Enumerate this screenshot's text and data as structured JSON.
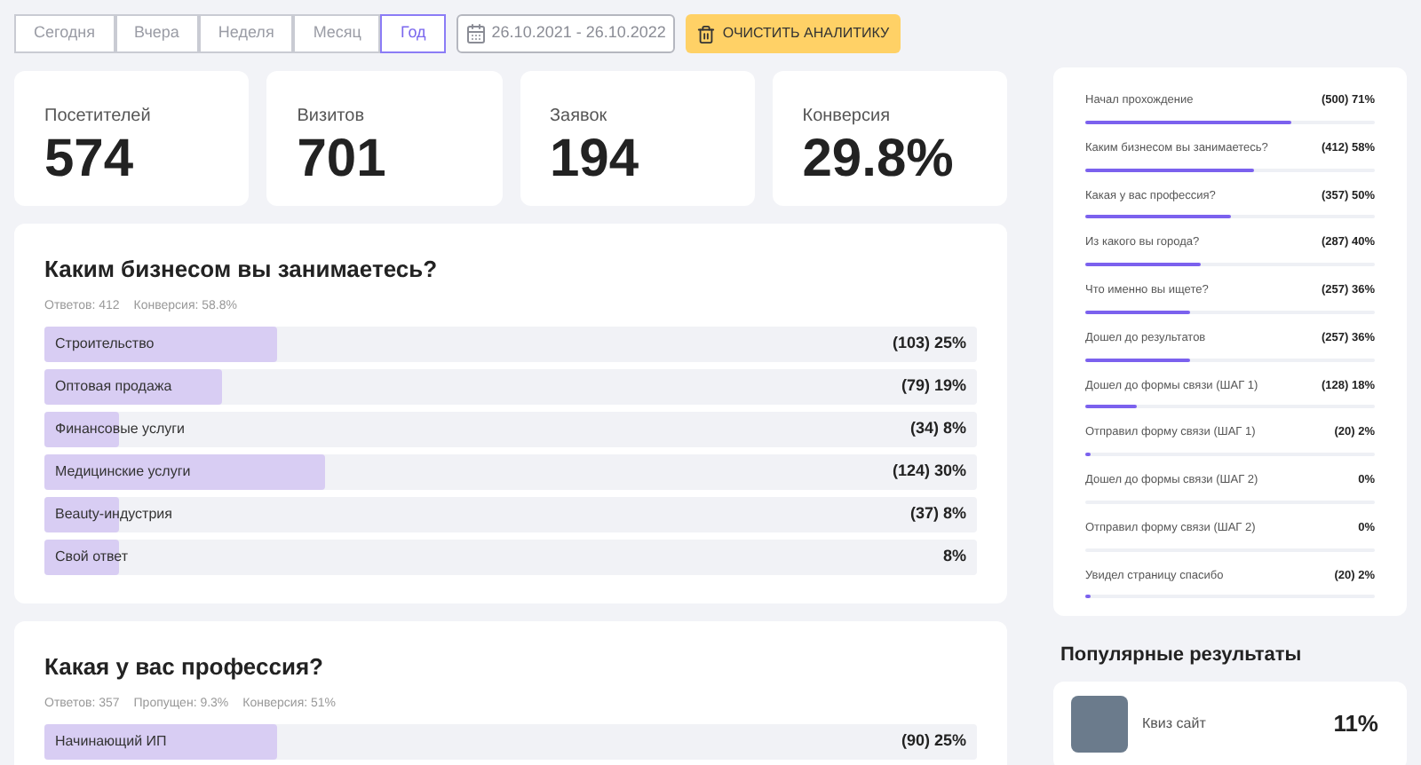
{
  "periods": [
    {
      "label": "Сегодня",
      "selected": false
    },
    {
      "label": "Вчера",
      "selected": false
    },
    {
      "label": "Неделя",
      "selected": false
    },
    {
      "label": "Месяц",
      "selected": false
    },
    {
      "label": "Год",
      "selected": true
    }
  ],
  "date_range": "26.10.2021 - 26.10.2022",
  "clear_button": "ОЧИСТИТЬ АНАЛИТИКУ",
  "stats": [
    {
      "label": "Посетителей",
      "value": "574"
    },
    {
      "label": "Визитов",
      "value": "701"
    },
    {
      "label": "Заявок",
      "value": "194"
    },
    {
      "label": "Конверсия",
      "value": "29.8%"
    }
  ],
  "questions": [
    {
      "title": "Каким бизнесом вы занимаетесь?",
      "meta": [
        "Ответов: 412",
        "Конверсия: 58.8%"
      ],
      "answers": [
        {
          "label": "Строительство",
          "reading": "(103) 25%",
          "level": 0.25
        },
        {
          "label": "Оптовая продажа",
          "reading": "(79) 19%",
          "level": 0.19
        },
        {
          "label": "Финансовые услуги",
          "reading": "(34) 8%",
          "level": 0.08
        },
        {
          "label": "Медицинские услуги",
          "reading": "(124) 30%",
          "level": 0.3
        },
        {
          "label": "Beauty-индустрия",
          "reading": "(37) 8%",
          "level": 0.08
        },
        {
          "label": "Свой ответ",
          "reading": "8%",
          "level": 0.08
        }
      ]
    },
    {
      "title": "Какая у вас профессия?",
      "meta": [
        "Ответов: 357",
        "Пропущен: 9.3%",
        "Конверсия: 51%"
      ],
      "answers": [
        {
          "label": "Начинающий ИП",
          "reading": "(90) 25%",
          "level": 0.25
        }
      ]
    }
  ],
  "funnel": [
    {
      "label": "Начал прохождение",
      "reading": "(500) 71%",
      "level": 0.71
    },
    {
      "label": "Каким бизнесом вы занимаетесь?",
      "reading": "(412) 58%",
      "level": 0.58
    },
    {
      "label": "Какая у вас профессия?",
      "reading": "(357) 50%",
      "level": 0.5
    },
    {
      "label": "Из какого вы города?",
      "reading": "(287) 40%",
      "level": 0.4
    },
    {
      "label": "Что именно вы ищете?",
      "reading": "(257) 36%",
      "level": 0.36
    },
    {
      "label": "Дошел до результатов",
      "reading": "(257) 36%",
      "level": 0.36
    },
    {
      "label": "Дошел до формы связи (ШАГ 1)",
      "reading": "(128) 18%",
      "level": 0.18
    },
    {
      "label": "Отправил форму связи (ШАГ 1)",
      "reading": "(20) 2%",
      "level": 0.02
    },
    {
      "label": "Дошел до формы связи (ШАГ 2)",
      "reading": "0%",
      "level": 0
    },
    {
      "label": "Отправил форму связи (ШАГ 2)",
      "reading": "0%",
      "level": 0
    },
    {
      "label": "Увидел страницу спасибо",
      "reading": "(20) 2%",
      "level": 0.02
    }
  ],
  "popular": {
    "title": "Популярные результаты",
    "items": [
      {
        "label": "Квиз сайт",
        "reading": "11%"
      }
    ]
  }
}
